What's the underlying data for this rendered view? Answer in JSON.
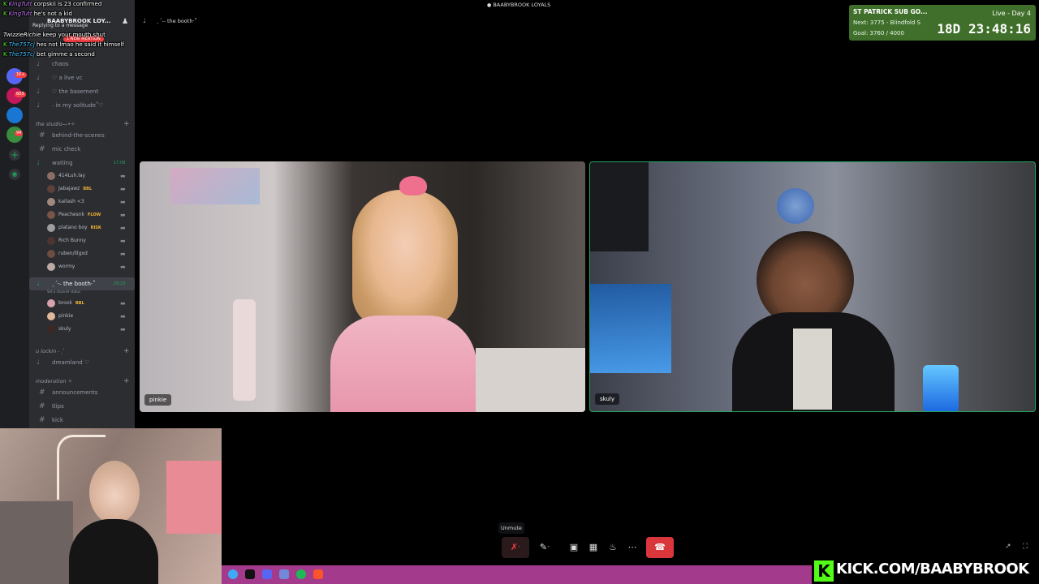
{
  "header": {
    "server_title": "BAABYBROOK LOYALS",
    "call_channel": "ˎˊ-˗ the booth·˚"
  },
  "chat": [
    {
      "user": "KingTutt",
      "text": "corpskii is 23 confirmed",
      "color": "#c77dff"
    },
    {
      "user": "KingTutt",
      "text": "he's not a kid",
      "color": "#c77dff"
    },
    {
      "user": "TwizzieRichie",
      "text": "keep your mouth shut",
      "color": "#ffffff"
    },
    {
      "user": "The757cj",
      "text": "hes not lmao he said it himself",
      "color": "#3ec1ff"
    },
    {
      "user": "The757cj",
      "text": "bet gimme a second",
      "color": "#3ec1ff"
    }
  ],
  "sidebar": {
    "server_name": "BAABYBROOK LOY...",
    "replying_text": "Replying to a message",
    "new_mention": "1 NEW MENTION",
    "top_channels": [
      {
        "icon": "speaker",
        "label": "chaos"
      },
      {
        "icon": "speaker",
        "label": "♡ a live vc"
      },
      {
        "icon": "speaker",
        "label": "♡ the basement"
      },
      {
        "icon": "speaker",
        "label": "˗ in my solitude˚♡"
      }
    ],
    "category_studio": "the studio—•✧",
    "studio_channels": [
      {
        "icon": "hash",
        "label": "behind-the-scenes"
      },
      {
        "icon": "hash",
        "label": "mic check"
      },
      {
        "icon": "speaker",
        "label": "waiting",
        "time": "17:08"
      }
    ],
    "waiting_members": [
      {
        "name": "414Luh.lay",
        "tag": "",
        "color": "#8d6e63"
      },
      {
        "name": "Jabajawz",
        "tag": "BBL",
        "color": "#5d4037"
      },
      {
        "name": "kailash <3",
        "tag": "",
        "color": "#a1887f"
      },
      {
        "name": "Peachesnk",
        "tag": "FLOW",
        "color": "#795548"
      },
      {
        "name": "platano boy",
        "tag": "RISK",
        "color": "#9e9e9e"
      },
      {
        "name": "Rich Bunny",
        "tag": "",
        "color": "#4e342e"
      },
      {
        "name": "ruben/lilgxd",
        "tag": "",
        "color": "#6d4c41"
      },
      {
        "name": "wormy",
        "tag": "",
        "color": "#bcaaa4"
      }
    ],
    "booth_channel": {
      "label": "ˎˊ-˗ the booth·˚",
      "time": "29:23",
      "status": "Set a channel status"
    },
    "booth_members": [
      {
        "name": "brook",
        "tag": "BBL",
        "color": "#d7a3b0"
      },
      {
        "name": "pinkie",
        "tag": "",
        "color": "#e0b89a"
      },
      {
        "name": "skuly",
        "tag": "",
        "color": "#3e2723"
      }
    ],
    "category_lockin": "u lockin ˗ˏˋ",
    "lockin_channels": [
      {
        "icon": "speaker",
        "label": "dreamland ♡"
      }
    ],
    "category_mod": "moderation ✧",
    "mod_channels": [
      {
        "icon": "hash",
        "label": "announcements"
      },
      {
        "icon": "hash",
        "label": "tlips"
      },
      {
        "icon": "hash",
        "label": "kick"
      }
    ],
    "rail_badges": [
      "1K+",
      "603",
      "94"
    ]
  },
  "participants": [
    {
      "name": "pinkie"
    },
    {
      "name": "skuly"
    }
  ],
  "subgoal": {
    "title": "ST PATRICK SUB GO...",
    "next": "Next: 3775 - Blindfold S",
    "goal": "Goal: 3760 / 4000",
    "status": "Live - Day 4",
    "timer": "18D 23:48:16"
  },
  "controls": {
    "tooltip": "Unmute"
  },
  "banner": {
    "text": "KICK.COM/BAABYBROOK"
  },
  "colors": {
    "accent_green": "#53fc18",
    "hangup_red": "#da373c",
    "banner_purple": "#a43a8c"
  }
}
